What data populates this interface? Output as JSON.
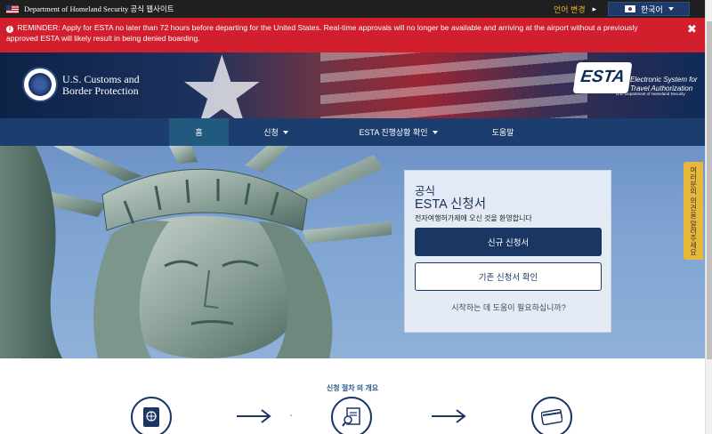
{
  "gov_banner": {
    "text": "Department of Homeland Security 공식 웹사이트",
    "language_change": "언어 변경",
    "arrow": "▸",
    "language_selected": "한국어"
  },
  "reminder": {
    "text": "REMINDER: Apply for ESTA no later than 72 hours before departing for the United States. Real-time approvals will no longer be available and arriving at the airport without a previously approved ESTA will likely result in being denied boarding.",
    "close": "✖"
  },
  "header": {
    "agency_line1": "U.S. Customs and",
    "agency_line2": "Border Protection",
    "esta_logo": "ESTA",
    "esta_sub1": "Electronic System for",
    "esta_sub2": "Travel Authorization",
    "esta_dept": "U.S. Department of Homeland Security"
  },
  "nav": {
    "items": [
      {
        "label": "홈"
      },
      {
        "label": "신청"
      },
      {
        "label": "ESTA 진행상황 확인"
      },
      {
        "label": "도움말"
      }
    ]
  },
  "card": {
    "small_title": "공식",
    "big_title": "ESTA 신청서",
    "welcome": "전자여행허가제에 오신 것을 환영합니다",
    "new_button": "신규 신청서",
    "existing_button": "기존 신청서 확인",
    "help": "시작하는 데 도움이 필요하십니까?"
  },
  "side_tab": "여러분의 의견을 알려주세요",
  "steps": {
    "title": "신청 절차 의 개요"
  },
  "colors": {
    "reminder": "#d11f2d",
    "nav": "#1b3e6e",
    "primary": "#1c3663",
    "accent": "#e8b83a"
  }
}
